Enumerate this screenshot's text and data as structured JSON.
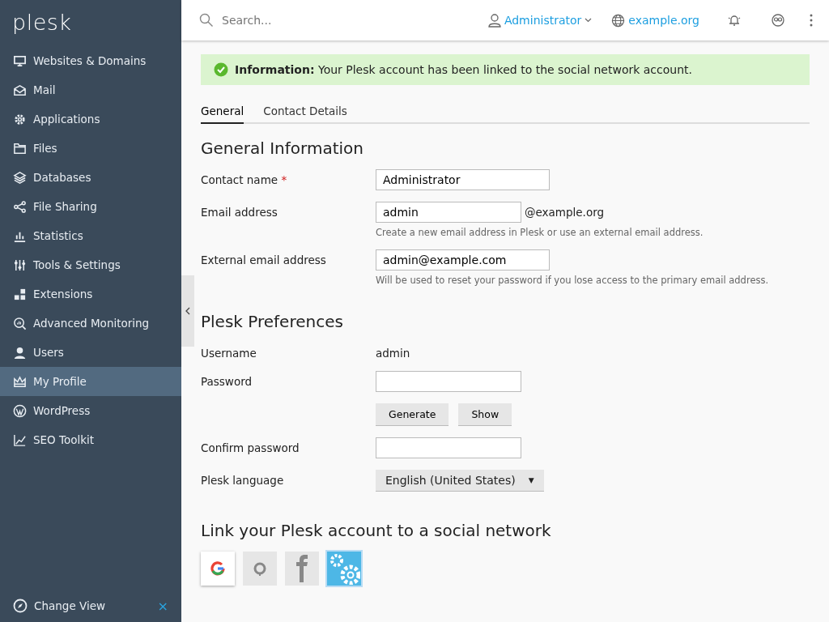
{
  "sidebar": {
    "logo": "plesk",
    "items": [
      {
        "label": "Websites & Domains",
        "selected": false
      },
      {
        "label": "Mail",
        "selected": false
      },
      {
        "label": "Applications",
        "selected": false
      },
      {
        "label": "Files",
        "selected": false
      },
      {
        "label": "Databases",
        "selected": false
      },
      {
        "label": "File Sharing",
        "selected": false
      },
      {
        "label": "Statistics",
        "selected": false
      },
      {
        "label": "Tools & Settings",
        "selected": false
      },
      {
        "label": "Extensions",
        "selected": false
      },
      {
        "label": "Advanced Monitoring",
        "selected": false
      },
      {
        "label": "Users",
        "selected": false
      },
      {
        "label": "My Profile",
        "selected": true
      },
      {
        "label": "WordPress",
        "selected": false
      },
      {
        "label": "SEO Toolkit",
        "selected": false
      }
    ],
    "footer": {
      "label": "Change View",
      "close": "×"
    }
  },
  "topbar": {
    "search": {
      "placeholder": "Search..."
    },
    "user": "Administrator",
    "domain": "example.org"
  },
  "message": {
    "title": "Information:",
    "text": "Your Plesk account has been linked to the social network account."
  },
  "tabs": [
    {
      "label": "General",
      "selected": true
    },
    {
      "label": "Contact Details",
      "selected": false
    }
  ],
  "sections": [
    {
      "title": "General Information",
      "fields": [
        {
          "kind": "text",
          "label": "Contact name",
          "required_mark": "*",
          "value": "Administrator"
        },
        {
          "kind": "email",
          "label": "Email address",
          "value": "admin",
          "suffix": "@example.org",
          "hint": "Create a new email address in Plesk or use an external email address."
        },
        {
          "kind": "text",
          "label": "External email address",
          "value": "admin@example.com",
          "hint": "Will be used to reset your password if you lose access to the primary email address."
        }
      ]
    },
    {
      "title": "Plesk Preferences",
      "fields": [
        {
          "kind": "static",
          "label": "Username",
          "value": "admin"
        },
        {
          "kind": "password",
          "label": "Password"
        },
        {
          "kind": "buttons",
          "buttons": [
            "Generate",
            "Show"
          ]
        },
        {
          "kind": "password",
          "label": "Confirm password"
        },
        {
          "kind": "select",
          "label": "Plesk language",
          "value": "English (United States)",
          "arrow": "▼"
        }
      ]
    }
  ],
  "social": {
    "title": "Link your Plesk account to a social network",
    "providers": [
      {
        "kind": "google",
        "linked": true,
        "selected": false
      },
      {
        "kind": "github",
        "linked": false,
        "selected": false
      },
      {
        "kind": "facebook",
        "linked": false,
        "selected": false
      },
      {
        "kind": "oauth",
        "linked": false,
        "selected": true
      }
    ]
  }
}
